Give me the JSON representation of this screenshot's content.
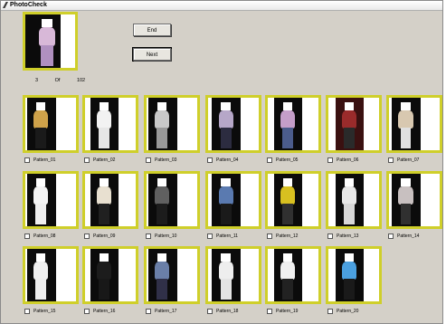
{
  "window": {
    "title": "PhotoCheck"
  },
  "buttons": {
    "end_label": "End",
    "next_label": "Next"
  },
  "counter": {
    "current": "3",
    "of_label": "Of",
    "total": "102"
  },
  "patterns": [
    {
      "label": "Pattern_01",
      "shirt": "#cfa24a",
      "pants": "#1a1a1a",
      "bg": "#0b0b0b"
    },
    {
      "label": "Pattern_02",
      "shirt": "#f2f2f2",
      "pants": "#e6e6e6",
      "bg": "#0b0b0b"
    },
    {
      "label": "Pattern_03",
      "shirt": "#c9c9c9",
      "pants": "#999999",
      "bg": "#0b0b0b"
    },
    {
      "label": "Pattern_04",
      "shirt": "#b6a7c8",
      "pants": "#2c2c40",
      "bg": "#0b0b0b"
    },
    {
      "label": "Pattern_05",
      "shirt": "#c59ec9",
      "pants": "#4b5c8c",
      "bg": "#0b0b0b"
    },
    {
      "label": "Pattern_06",
      "shirt": "#9a2b2b",
      "pants": "#2a2a2a",
      "bg": "#3a1010"
    },
    {
      "label": "Pattern_07",
      "shirt": "#d8c8b0",
      "pants": "#e0e0e0",
      "bg": "#0b0b0b"
    },
    {
      "label": "Pattern_08",
      "shirt": "#f4f4f4",
      "pants": "#efefef",
      "bg": "#0b0b0b"
    },
    {
      "label": "Pattern_09",
      "shirt": "#e8e0d0",
      "pants": "#202020",
      "bg": "#0b0b0b"
    },
    {
      "label": "Pattern_10",
      "shirt": "#606060",
      "pants": "#1c1c1c",
      "bg": "#0b0b0b"
    },
    {
      "label": "Pattern_11",
      "shirt": "#5a7ab0",
      "pants": "#1a1a1a",
      "bg": "#0b0b0b"
    },
    {
      "label": "Pattern_12",
      "shirt": "#d8c020",
      "pants": "#303030",
      "bg": "#0b0b0b"
    },
    {
      "label": "Pattern_13",
      "shirt": "#e8e8e8",
      "pants": "#d8d8d8",
      "bg": "#0b0b0b"
    },
    {
      "label": "Pattern_14",
      "shirt": "#c8c0c0",
      "pants": "#303030",
      "bg": "#0b0b0b"
    },
    {
      "label": "Pattern_15",
      "shirt": "#f0f0f0",
      "pants": "#eeeeee",
      "bg": "#0b0b0b"
    },
    {
      "label": "Pattern_16",
      "shirt": "#1c1c1c",
      "pants": "#181818",
      "bg": "#0b0b0b"
    },
    {
      "label": "Pattern_17",
      "shirt": "#6a7fa8",
      "pants": "#303048",
      "bg": "#0b0b0b"
    },
    {
      "label": "Pattern_18",
      "shirt": "#eeeeee",
      "pants": "#e4e4e4",
      "bg": "#0b0b0b"
    },
    {
      "label": "Pattern_19",
      "shirt": "#f0f0f0",
      "pants": "#222222",
      "bg": "#0b0b0b"
    },
    {
      "label": "Pattern_20",
      "shirt": "#4aa0e0",
      "pants": "#1a1a1a",
      "bg": "#0b0b0b"
    }
  ],
  "preview": {
    "shirt": "#d8b8d8",
    "pants": "#b090c0",
    "bg": "#0b0b0b"
  },
  "colors": {
    "frame": "#cfcf2a",
    "window_bg": "#d4d0c8"
  }
}
